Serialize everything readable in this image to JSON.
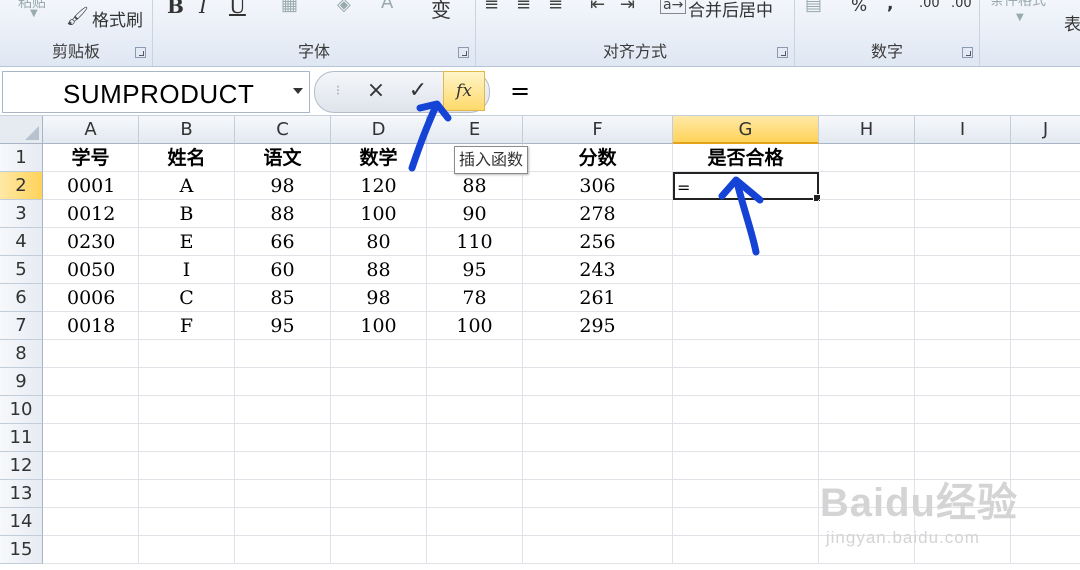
{
  "ribbon": {
    "clipboard": {
      "label": "剪贴板",
      "paste": "粘贴",
      "format_painter": "格式刷"
    },
    "font": {
      "label": "字体",
      "bold": "B",
      "italic": "I",
      "underline": "U",
      "font_color": "A",
      "phonetic": "变"
    },
    "alignment": {
      "label": "对齐方式",
      "merge_center": "合并后居中"
    },
    "number": {
      "label": "数字",
      "percent": "%",
      "comma": ",",
      "inc_decimal": ".00",
      "dec_decimal": ".00"
    },
    "styles": {
      "cond_format": "条件格式",
      "table": "表"
    }
  },
  "formula_bar": {
    "name_box": "SUMPRODUCT",
    "cancel": "×",
    "enter": "✓",
    "fx": "fx",
    "formula": "="
  },
  "tooltip": "插入函数",
  "columns": [
    "A",
    "B",
    "C",
    "D",
    "E",
    "F",
    "G",
    "H",
    "I",
    "J"
  ],
  "rows": [
    "1",
    "2",
    "3",
    "4",
    "5",
    "6",
    "7",
    "8",
    "9",
    "10",
    "11",
    "12",
    "13",
    "14",
    "15"
  ],
  "table": {
    "headers": [
      "学号",
      "姓名",
      "语文",
      "数学",
      "",
      "分数",
      "是否合格"
    ],
    "data": [
      [
        "0001",
        "A",
        "98",
        "120",
        "88",
        "306"
      ],
      [
        "0012",
        "B",
        "88",
        "100",
        "90",
        "278"
      ],
      [
        "0230",
        "E",
        "66",
        "80",
        "110",
        "256"
      ],
      [
        "0050",
        "I",
        "60",
        "88",
        "95",
        "243"
      ],
      [
        "0006",
        "C",
        "85",
        "98",
        "78",
        "261"
      ],
      [
        "0018",
        "F",
        "95",
        "100",
        "100",
        "295"
      ]
    ]
  },
  "active_cell": {
    "ref": "G2",
    "value": "="
  },
  "watermark": {
    "main": "Baidu经验",
    "sub": "jingyan.baidu.com"
  },
  "colors": {
    "selected_header": "#ffd35a",
    "annotation": "#1443d6"
  }
}
